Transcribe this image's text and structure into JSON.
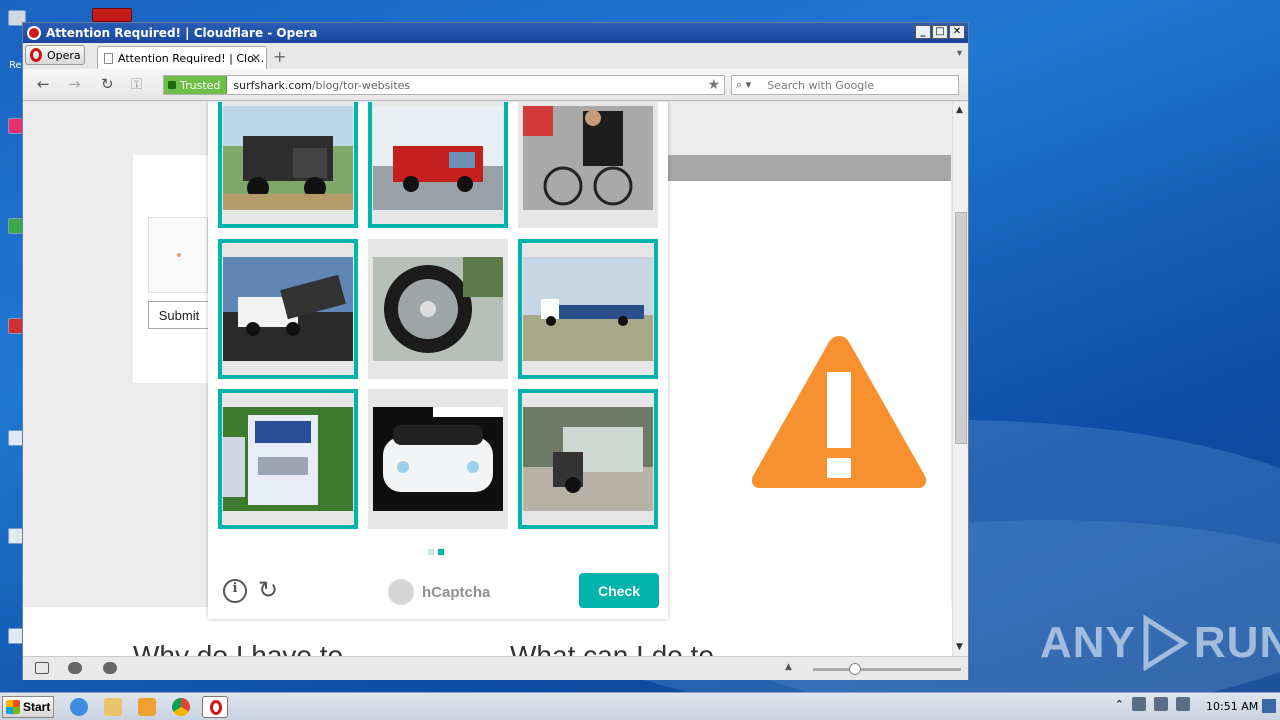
{
  "window": {
    "title": "Attention Required! | Cloudflare - Opera",
    "buttons": [
      "_",
      "□",
      "✕"
    ]
  },
  "browser": {
    "menu_label": "Opera",
    "tab_title": "Attention Required! | Clo...",
    "tab_close": "✕",
    "new_tab": "+",
    "tab_menu": "▾",
    "nav": {
      "back": "←",
      "forward": "→",
      "reload": "↻",
      "keys": "⚿"
    },
    "security_badge": "Trusted",
    "url_host": "surfshark.com",
    "url_path": "/blog/tor-websites",
    "bookmark_icon": "★",
    "search_placeholder": "Search with Google"
  },
  "page": {
    "submit_label": "Submit",
    "heading_left": "Why do I have to",
    "heading_right": "What can I do to",
    "warning_color": "#f7902e"
  },
  "captcha": {
    "tiles": [
      {
        "subject": "dump-truck",
        "selected": true
      },
      {
        "subject": "fire-truck",
        "selected": true
      },
      {
        "subject": "bicycle-shop",
        "selected": false
      },
      {
        "subject": "tow-truck",
        "selected": true
      },
      {
        "subject": "motorcycle-wheel",
        "selected": false
      },
      {
        "subject": "flatbed-truck",
        "selected": true
      },
      {
        "subject": "semi-truck",
        "selected": true
      },
      {
        "subject": "white-car",
        "selected": false
      },
      {
        "subject": "utility-truck",
        "selected": true
      }
    ],
    "info_icon": "i",
    "refresh_icon": "↻",
    "brand": "hCaptcha",
    "check_label": "Check",
    "accent": "#00b3ad",
    "pages": 2,
    "current_page": 2
  },
  "taskbar": {
    "start_label": "Start",
    "clock": "10:51 AM",
    "tray_arrow": "⌃"
  },
  "watermark": {
    "left": "ANY",
    "right": "RUN"
  }
}
